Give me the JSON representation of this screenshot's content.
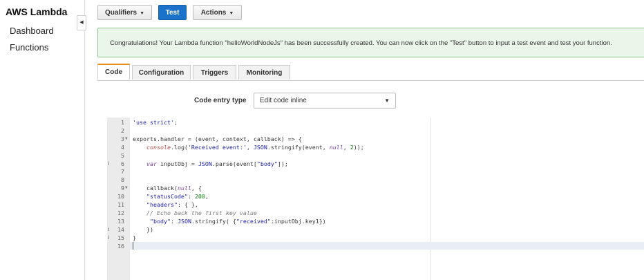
{
  "sidebar": {
    "title": "AWS Lambda",
    "items": [
      {
        "label": "Dashboard"
      },
      {
        "label": "Functions"
      }
    ],
    "collapse_glyph": "◀"
  },
  "toolbar": {
    "qualifiers_label": "Qualifiers",
    "test_label": "Test",
    "actions_label": "Actions"
  },
  "alert": {
    "message": "Congratulations! Your Lambda function \"helloWorldNodeJs\" has been successfully created. You can now click on the \"Test\" button to input a test event and test your function."
  },
  "tabs": [
    {
      "label": "Code",
      "active": true
    },
    {
      "label": "Configuration"
    },
    {
      "label": "Triggers"
    },
    {
      "label": "Monitoring"
    }
  ],
  "code_entry": {
    "label": "Code entry type",
    "value": "Edit code inline"
  },
  "editor": {
    "active_line": 16,
    "lines": [
      {
        "n": "1",
        "tokens": [
          {
            "t": "'use strict'",
            "c": "str"
          },
          {
            "t": ";",
            "c": "op"
          }
        ]
      },
      {
        "n": "2",
        "tokens": []
      },
      {
        "n": "3",
        "fold": true,
        "tokens": [
          {
            "t": "exports.handler = (event, context, callback) => {",
            "c": "op"
          }
        ]
      },
      {
        "n": "4",
        "tokens": [
          {
            "t": "    ",
            "c": "op"
          },
          {
            "t": "console",
            "c": "fn"
          },
          {
            "t": ".log(",
            "c": "op"
          },
          {
            "t": "'Received event:'",
            "c": "str"
          },
          {
            "t": ", ",
            "c": "op"
          },
          {
            "t": "JSON",
            "c": "obj"
          },
          {
            "t": ".stringify(event, ",
            "c": "op"
          },
          {
            "t": "null",
            "c": "kw"
          },
          {
            "t": ", ",
            "c": "op"
          },
          {
            "t": "2",
            "c": "num"
          },
          {
            "t": "));",
            "c": "op"
          }
        ]
      },
      {
        "n": "5",
        "tokens": []
      },
      {
        "n": "6",
        "info": true,
        "tokens": [
          {
            "t": "    ",
            "c": "op"
          },
          {
            "t": "var",
            "c": "kw"
          },
          {
            "t": " inputObj = ",
            "c": "op"
          },
          {
            "t": "JSON",
            "c": "obj"
          },
          {
            "t": ".parse(event[",
            "c": "op"
          },
          {
            "t": "\"body\"",
            "c": "str"
          },
          {
            "t": "]);",
            "c": "op"
          }
        ]
      },
      {
        "n": "7",
        "tokens": []
      },
      {
        "n": "8",
        "tokens": []
      },
      {
        "n": "9",
        "fold": true,
        "tokens": [
          {
            "t": "    callback(",
            "c": "op"
          },
          {
            "t": "null",
            "c": "kw"
          },
          {
            "t": ", {",
            "c": "op"
          }
        ]
      },
      {
        "n": "10",
        "tokens": [
          {
            "t": "    ",
            "c": "op"
          },
          {
            "t": "\"statusCode\"",
            "c": "str"
          },
          {
            "t": ": ",
            "c": "op"
          },
          {
            "t": "200",
            "c": "num"
          },
          {
            "t": ",",
            "c": "op"
          }
        ]
      },
      {
        "n": "11",
        "tokens": [
          {
            "t": "    ",
            "c": "op"
          },
          {
            "t": "\"headers\"",
            "c": "str"
          },
          {
            "t": ": { },",
            "c": "op"
          }
        ]
      },
      {
        "n": "12",
        "tokens": [
          {
            "t": "    ",
            "c": "op"
          },
          {
            "t": "// Echo back the first key value",
            "c": "cmt"
          }
        ]
      },
      {
        "n": "13",
        "tokens": [
          {
            "t": "     ",
            "c": "op"
          },
          {
            "t": "\"body\"",
            "c": "str"
          },
          {
            "t": ": ",
            "c": "op"
          },
          {
            "t": "JSON",
            "c": "obj"
          },
          {
            "t": ".stringify( {",
            "c": "op"
          },
          {
            "t": "\"received\"",
            "c": "str"
          },
          {
            "t": ":inputObj.key1})",
            "c": "op"
          }
        ]
      },
      {
        "n": "14",
        "info": true,
        "tokens": [
          {
            "t": "    })",
            "c": "op"
          }
        ]
      },
      {
        "n": "15",
        "info": true,
        "tokens": [
          {
            "t": "}",
            "c": "op"
          }
        ]
      },
      {
        "n": "16",
        "tokens": []
      }
    ]
  }
}
